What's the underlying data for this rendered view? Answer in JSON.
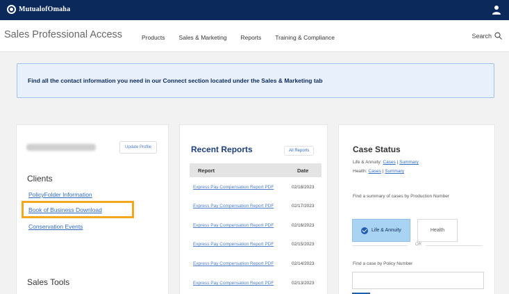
{
  "topbar": {
    "logo_text": "MutualofOmaha"
  },
  "header": {
    "brand": "Sales Professional Access",
    "nav": [
      "Products",
      "Sales & Marketing",
      "Reports",
      "Training & Compliance"
    ],
    "search_label": "Search"
  },
  "banner": {
    "text": "Find all the contact information you need in our Connect section located under the Sales & Marketing tab"
  },
  "left": {
    "update_profile": "Update Profile",
    "clients_heading": "Clients",
    "links": [
      "PolicyFolder Information",
      "Book of Business Download",
      "Conservation Events"
    ],
    "sales_tools_heading": "Sales Tools"
  },
  "reports": {
    "title": "Recent Reports",
    "all_reports": "All Reports",
    "col_report": "Report",
    "col_date": "Date",
    "rows": [
      {
        "name": "Express Pay Compensation Report PDF",
        "date": "02/18/2023"
      },
      {
        "name": "Express Pay Compensation Report PDF",
        "date": "02/17/2023"
      },
      {
        "name": "Express Pay Compensation Report PDF",
        "date": "02/16/2023"
      },
      {
        "name": "Express Pay Compensation Report PDF",
        "date": "02/15/2023"
      },
      {
        "name": "Express Pay Compensation Report PDF",
        "date": "02/14/2023"
      },
      {
        "name": "Express Pay Compensation Report PDF",
        "date": "02/13/2023"
      }
    ]
  },
  "case_status": {
    "title": "Case Status",
    "life_label": "Life & Annuity:",
    "health_label": "Health:",
    "cases": "Cases",
    "summary": "Summary",
    "prod_prompt": "Find a summary of cases by Production Number",
    "toggle_life": "Life & Annuity",
    "toggle_health": "Health",
    "or_text": "OR",
    "policy_prompt": "Find a case by Policy Number"
  }
}
